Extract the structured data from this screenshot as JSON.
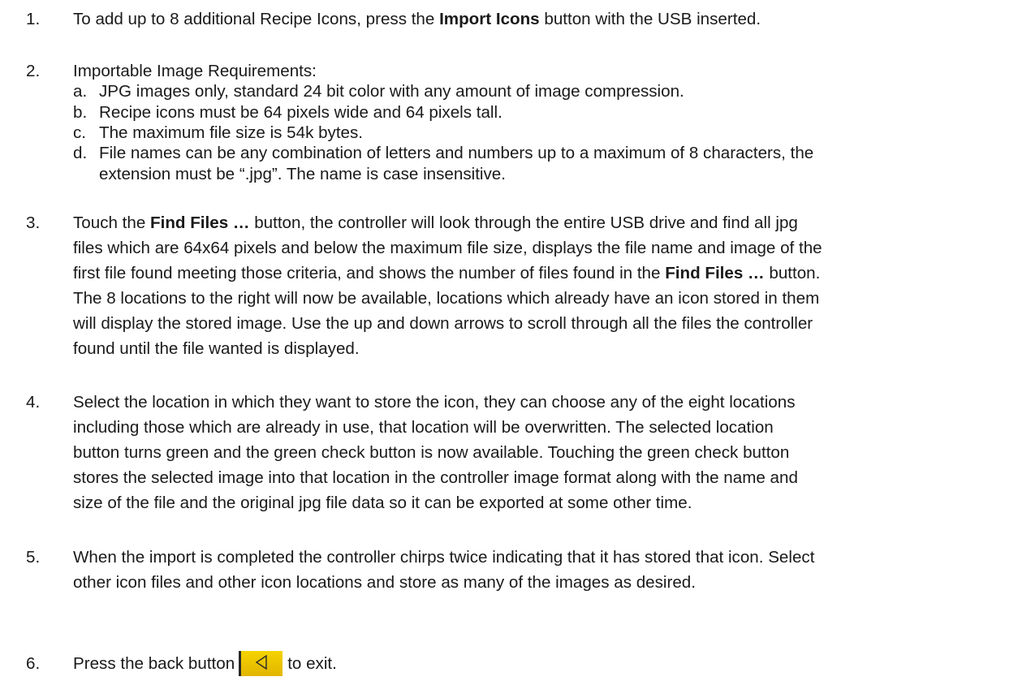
{
  "items": [
    {
      "number": "1.",
      "parts": [
        "To add up to 8 additional Recipe Icons, press the ",
        "Import Icons",
        " button with the USB inserted."
      ]
    },
    {
      "number": "2.",
      "intro": "Importable Image Requirements:",
      "subitems": [
        {
          "letter": "a.",
          "lines": [
            "JPG images only, standard 24 bit color with any amount of image compression."
          ]
        },
        {
          "letter": "b.",
          "lines": [
            "Recipe icons must be 64 pixels wide and 64 pixels tall."
          ]
        },
        {
          "letter": "c.",
          "lines": [
            "The maximum file size is 54k bytes."
          ]
        },
        {
          "letter": "d.",
          "lines": [
            "File names can be any combination of letters and numbers up to a maximum of 8 characters, the",
            "extension must be “.jpg”. The name is case insensitive."
          ]
        }
      ]
    },
    {
      "number": "3.",
      "l1_a": "Touch the ",
      "l1_b": "Find Files …",
      "l1_c": " button, the controller will look through the entire USB drive and find all jpg",
      "l2": "files which are 64x64 pixels and below the maximum file size, displays the file name and image of the",
      "l3_a": "first file found meeting those criteria, and shows the number of files found in the ",
      "l3_b": "Find Files …",
      "l3_c": " button.",
      "l4": "The 8 locations to the right will now be available, locations which already have an icon stored in them",
      "l5": "will display the stored image. Use the up and down arrows to scroll through all the files the controller",
      "l6": "found until the file wanted is displayed."
    },
    {
      "number": "4.",
      "lines": [
        "Select the location in which they want to store the icon, they can choose any of the eight locations",
        "including those which are already in use, that location will be overwritten.  The selected location",
        "button turns green and the green check button is now available. Touching the green check button",
        "stores the selected image into that location in the controller image format along with the name and",
        "size of the file and the original jpg file data so it can be exported at some other time."
      ]
    },
    {
      "number": "5.",
      "lines": [
        "When the import is completed the controller chirps twice indicating that it has stored that icon. Select",
        "other icon files and other icon locations and store as many of the images as desired."
      ]
    },
    {
      "number": "6.",
      "before": "Press the back button",
      "after": "to exit.",
      "button_icon": "back-arrow-icon",
      "button_color": "#f2cc00"
    }
  ]
}
